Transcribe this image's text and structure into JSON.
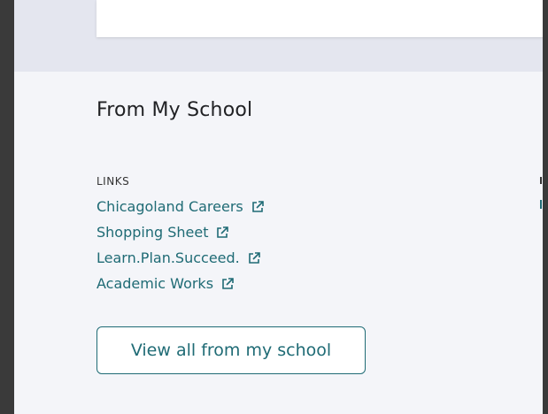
{
  "section": {
    "title": "From My School"
  },
  "links": {
    "heading": "LINKS",
    "items": [
      {
        "label": "Chicagoland Careers",
        "icon": "external-link-icon"
      },
      {
        "label": "Shopping Sheet",
        "icon": "external-link-icon"
      },
      {
        "label": "Learn.Plan.Succeed.",
        "icon": "external-link-icon"
      },
      {
        "label": "Academic Works",
        "icon": "external-link-icon"
      }
    ]
  },
  "actions": {
    "view_all_label": "View all from my school"
  },
  "colors": {
    "accent": "#1f6b75",
    "background": "#f4f5f9",
    "band": "#e4e6ef"
  }
}
